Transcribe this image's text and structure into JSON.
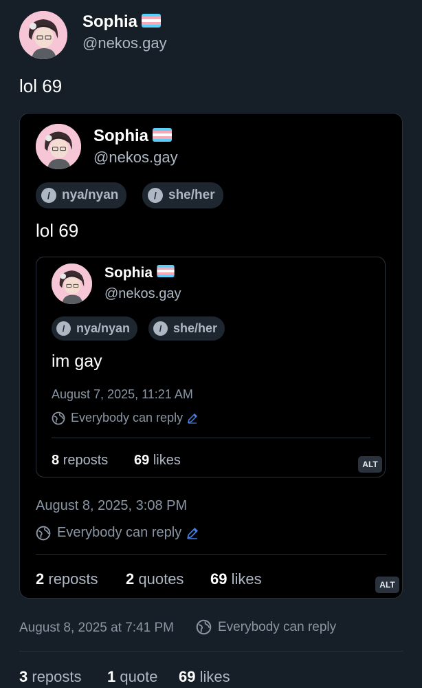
{
  "author": {
    "name": "Sophia",
    "handle": "@nekos.gay",
    "flag_icon": "transgender-flag-emoji"
  },
  "post": {
    "text": "lol 69",
    "timestamp": "August 8, 2025 at 7:41 PM",
    "reply_setting": "Everybody can reply",
    "stats": {
      "reposts_count": "3",
      "reposts_label": "reposts",
      "quotes_count": "1",
      "quotes_label": "quote",
      "likes_count": "69",
      "likes_label": "likes"
    }
  },
  "quote1": {
    "name": "Sophia",
    "handle": "@nekos.gay",
    "pronouns": [
      "nya/nyan",
      "she/her"
    ],
    "text": "lol 69",
    "timestamp": "August 8, 2025, 3:08 PM",
    "reply_setting": "Everybody can reply",
    "stats": {
      "reposts_count": "2",
      "reposts_label": "reposts",
      "quotes_count": "2",
      "quotes_label": "quotes",
      "likes_count": "69",
      "likes_label": "likes"
    },
    "alt_label": "ALT"
  },
  "quote2": {
    "name": "Sophia",
    "handle": "@nekos.gay",
    "pronouns": [
      "nya/nyan",
      "she/her"
    ],
    "text": "im gay",
    "timestamp": "August 7, 2025, 11:21 AM",
    "reply_setting": "Everybody can reply",
    "stats": {
      "reposts_count": "8",
      "reposts_label": "reposts",
      "likes_count": "69",
      "likes_label": "likes"
    },
    "alt_label": "ALT"
  },
  "colors": {
    "background": "#161e27",
    "card": "#000000",
    "accent": "#4a7fe0",
    "flag_blue": "#5bcefa",
    "flag_pink": "#f5a9b8"
  }
}
